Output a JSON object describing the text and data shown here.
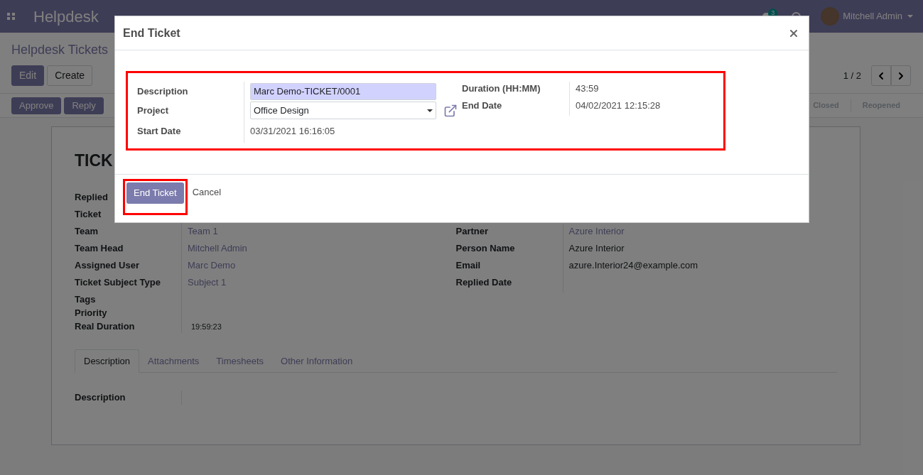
{
  "nav": {
    "app_title": "Helpdesk",
    "message_count": "3",
    "user": "Mitchell Admin"
  },
  "breadcrumb": "Helpdesk Tickets",
  "main_buttons": [
    {
      "label": "Edit",
      "kind": "primary"
    },
    {
      "label": "Create",
      "kind": "secondary"
    }
  ],
  "pager": "1 / 2",
  "action_buttons": [
    {
      "label": "Approve",
      "kind": "primary"
    },
    {
      "label": "Reply",
      "kind": "primary"
    }
  ],
  "stages": [
    {
      "label": "Closed",
      "selected": false
    },
    {
      "label": "Reopened",
      "selected": false
    }
  ],
  "sheet": {
    "title": "TICK",
    "left_fields": [
      {
        "label": "Replied",
        "kind": "text"
      },
      {
        "label": "Ticket",
        "kind": "text"
      },
      {
        "label": "Team",
        "value": "Team 1",
        "kind": "link"
      },
      {
        "label": "Team Head",
        "value": "Mitchell Admin",
        "kind": "link"
      },
      {
        "label": "Assigned User",
        "value": "Marc Demo",
        "kind": "link"
      },
      {
        "label": "Ticket Subject Type",
        "value": "Subject 1",
        "kind": "link"
      },
      {
        "label": "Tags",
        "kind": "compact"
      },
      {
        "label": "Priority",
        "kind": "compact"
      },
      {
        "label": "Real Duration",
        "value": "19:59:23",
        "kind": "small"
      }
    ],
    "right_fields": [
      {
        "label": "Partner",
        "value": "Azure Interior",
        "kind": "link"
      },
      {
        "label": "Person Name",
        "value": "Azure Interior",
        "kind": "text"
      },
      {
        "label": "Email",
        "value": "azure.Interior24@example.com",
        "kind": "text"
      },
      {
        "label": "Replied Date",
        "kind": "text"
      }
    ],
    "tabs": [
      {
        "label": "Description",
        "selected": true
      },
      {
        "label": "Attachments",
        "selected": false
      },
      {
        "label": "Timesheets",
        "selected": false
      },
      {
        "label": "Other Information",
        "selected": false
      }
    ],
    "tab_field": "Description"
  },
  "dialog": {
    "title": "End Ticket",
    "left_fields": [
      {
        "label": "Description",
        "value": "Marc Demo-TICKET/0001",
        "kind": "input"
      },
      {
        "label": "Project",
        "value": "Office Design",
        "kind": "select"
      },
      {
        "label": "Start Date",
        "value": "03/31/2021 16:16:05",
        "kind": "text"
      }
    ],
    "right_fields": [
      {
        "label": "Duration (HH:MM)",
        "value": "43:59"
      },
      {
        "label": "End Date",
        "value": "04/02/2021 12:15:28"
      }
    ],
    "buttons": [
      {
        "label": "End Ticket",
        "kind": "primary"
      },
      {
        "label": "Cancel",
        "kind": "link"
      }
    ]
  }
}
